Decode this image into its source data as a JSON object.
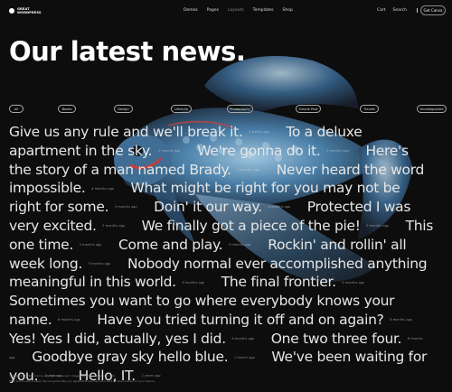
{
  "header": {
    "logo": "GREAT\nWORDPRESS",
    "nav": [
      "Demos",
      "Pages",
      "Layouts",
      "Templates",
      "Shop"
    ],
    "cart": "Cart",
    "search": "Search",
    "menu_icon": "vertical-bar-icon",
    "cta": "Get Canva"
  },
  "page": {
    "title": "Our latest news."
  },
  "categories": [
    "All",
    "Books",
    "Design",
    "Lifestyle",
    "Photography",
    "Simple Post",
    "Travels",
    "Uncategorized"
  ],
  "posts": [
    {
      "title": "Give us any rule and we'll break it.",
      "date": "2 weeks ago"
    },
    {
      "title": "To a deluxe apartment in the sky.",
      "date": "2 months ago"
    },
    {
      "title": "We're gonna do it.",
      "date": "2 months ago"
    },
    {
      "title": "Here's the story of a man named Brady.",
      "date": "4 months ago"
    },
    {
      "title": "Never heard the word impossible.",
      "date": "4 months ago"
    },
    {
      "title": "What might be right for you may not be right for some.",
      "date": "5 months ago"
    },
    {
      "title": "Doin' it our way.",
      "date": "6 months ago"
    },
    {
      "title": "Protected I was very excited.",
      "date": "5 months ago"
    },
    {
      "title": "We finally got a piece of the pie!",
      "date": "5 months ago"
    },
    {
      "title": "This one time.",
      "date": "5 months ago"
    },
    {
      "title": "Come and play.",
      "date": "5 months ago"
    },
    {
      "title": "Rockin' and rollin' all week long.",
      "date": "5 months ago"
    },
    {
      "title": "Nobody normal ever accomplished anything meaningful in this world.",
      "date": "6 months ago"
    },
    {
      "title": "The final frontier.",
      "date": "6 months ago"
    },
    {
      "title": "Sometimes you want to go where everybody knows your name.",
      "date": "6 months ago"
    },
    {
      "title": "Have you tried turning it off and on again?",
      "date": "6 months ago"
    },
    {
      "title": "Yes! Yes I did, actually, yes I did.",
      "date": "6 months ago"
    },
    {
      "title": "One two three four.",
      "date": "8 months ago"
    },
    {
      "title": "Goodbye gray sky hello blue.",
      "date": "1 month ago"
    },
    {
      "title": "We've been waiting for you.",
      "date": "1 year ago"
    },
    {
      "title": "Hello, IT.",
      "date": "2 years ago"
    }
  ],
  "footer": {
    "line1": "© Copyright 2024 Canva. All rights reserved. Images by Unsplash and Envato.",
    "line2": "This demo uses cookies. By using this site you agree that we may store and access cookies on your device."
  },
  "colors": {
    "background": "#0d0d0d",
    "text": "#e6e6e6",
    "fish_blue": "#4a7fa8"
  }
}
